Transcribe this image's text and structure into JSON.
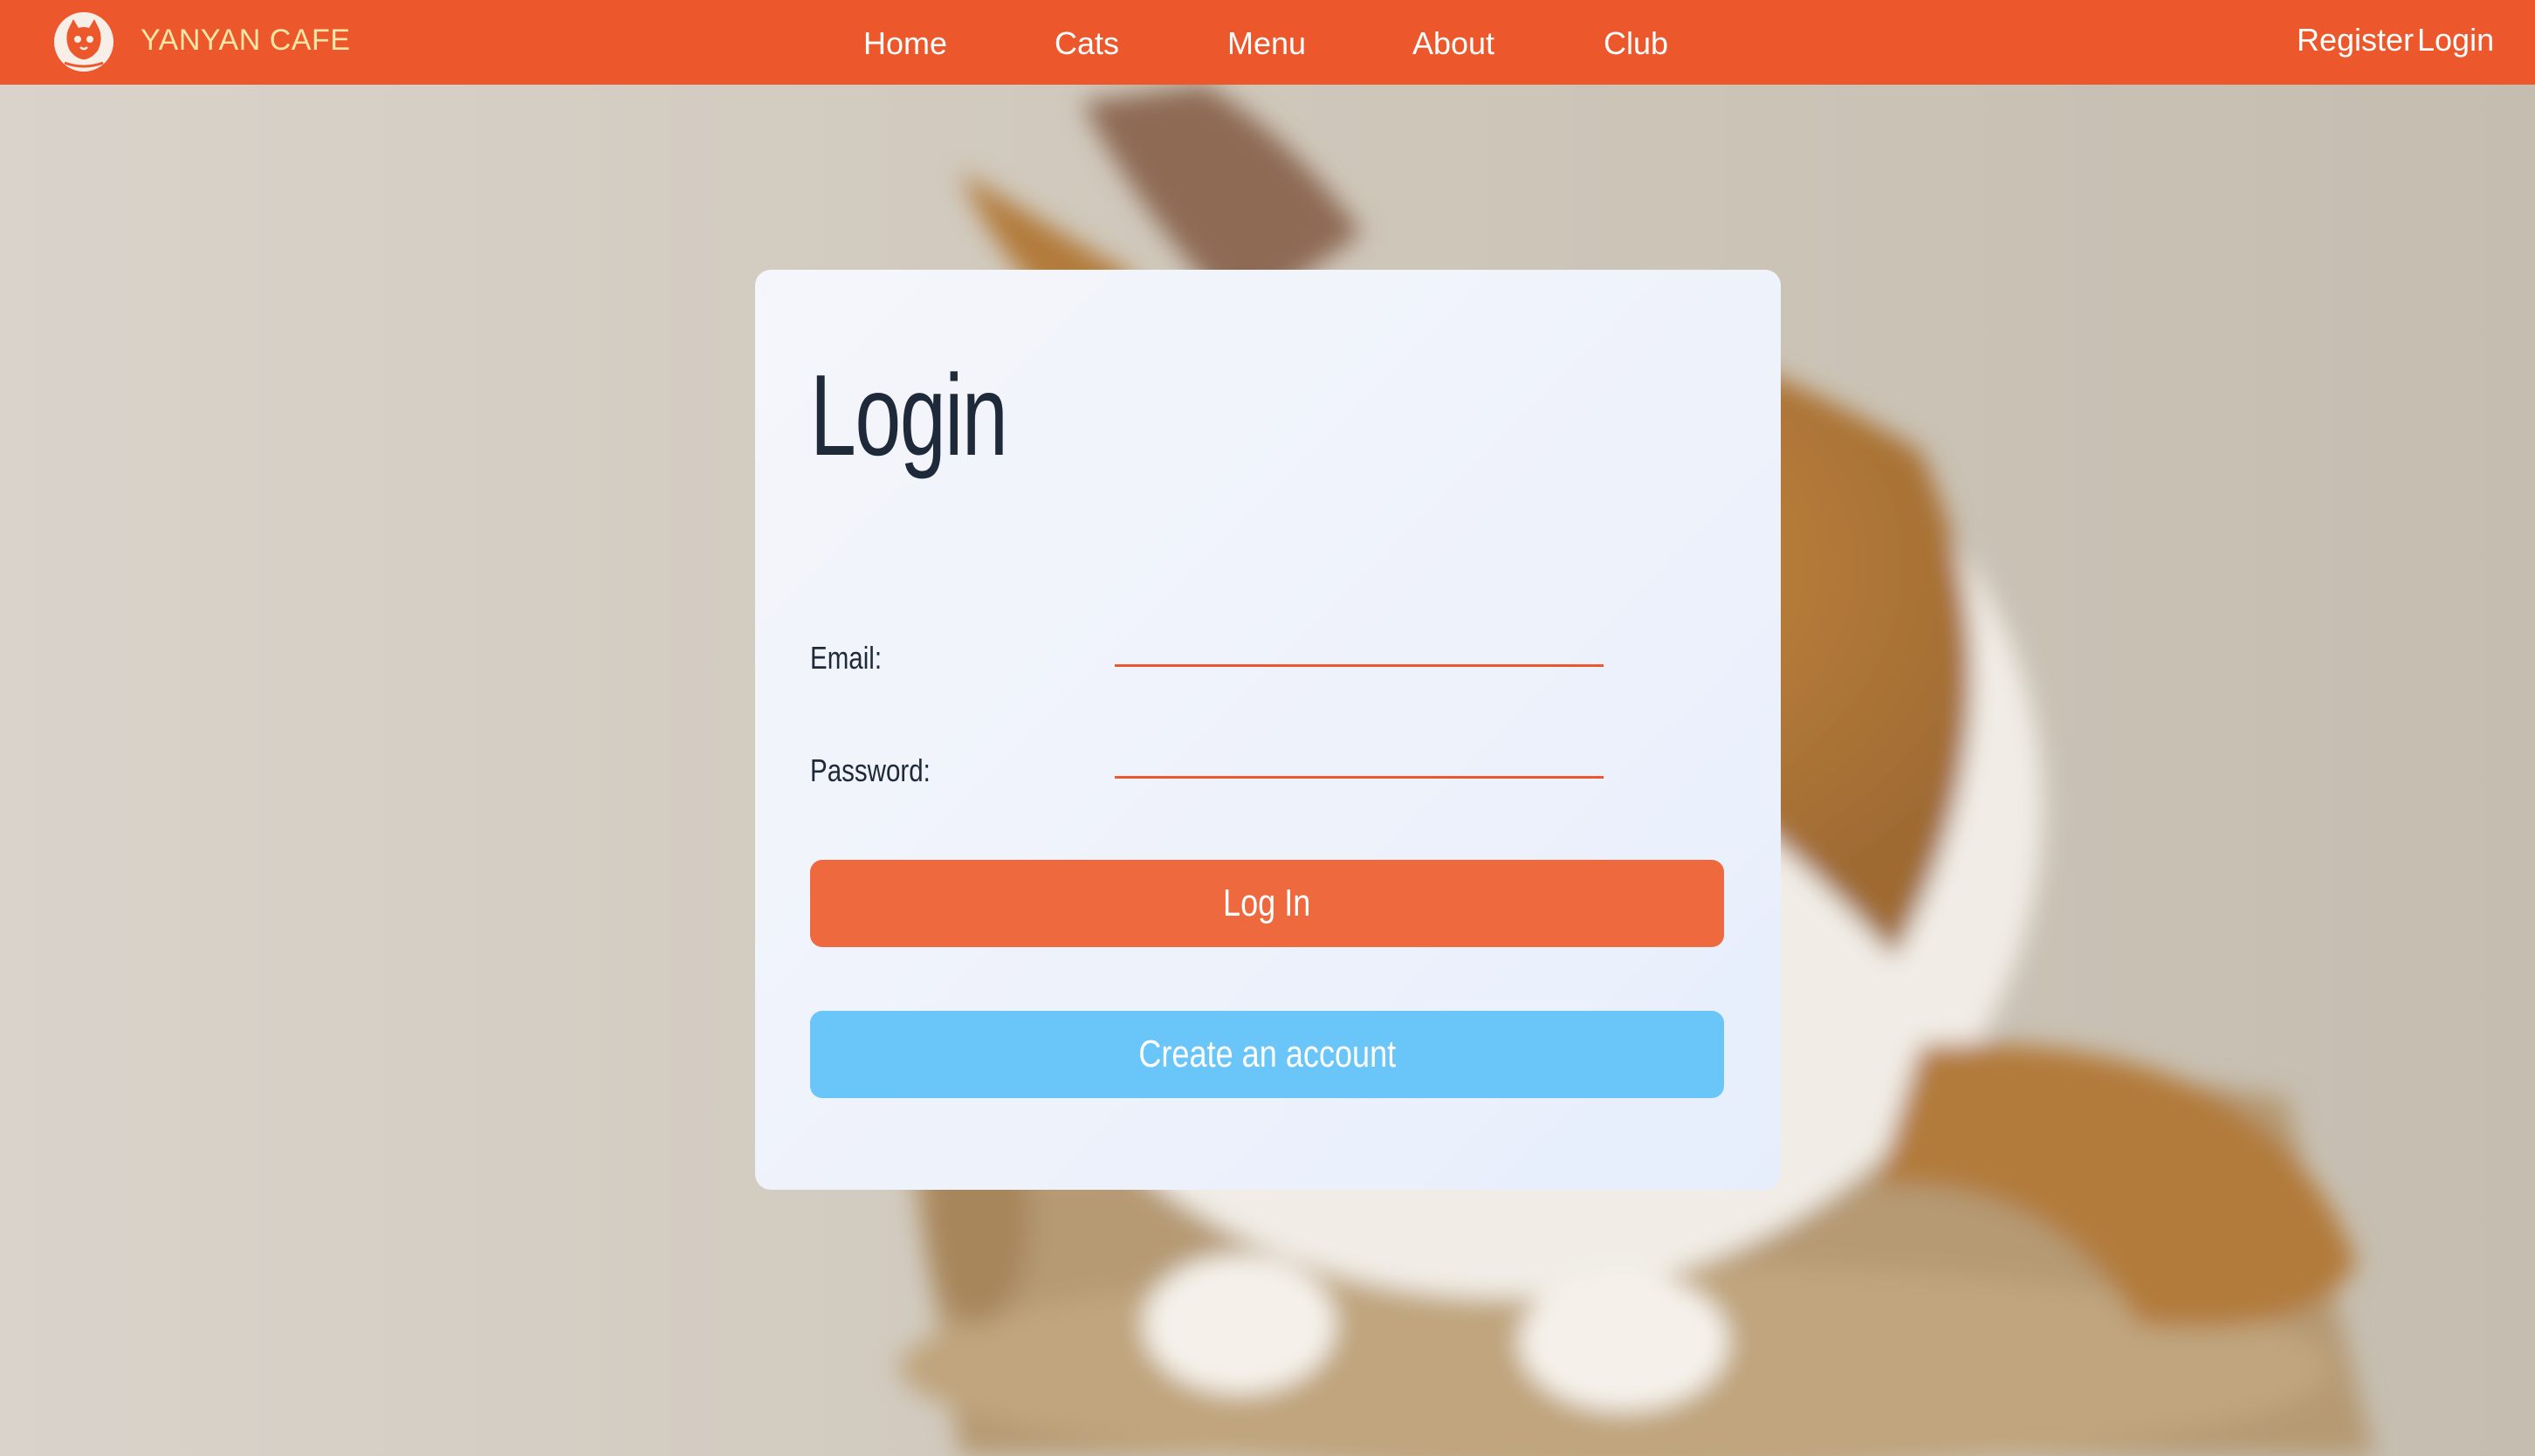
{
  "brand": {
    "name": "YANYAN CAFE",
    "logo_icon": "cat-logo-icon"
  },
  "nav": {
    "links": [
      "Home",
      "Cats",
      "Menu",
      "About",
      "Club"
    ],
    "register_label": "Register",
    "login_label": "Login"
  },
  "login_card": {
    "title": "Login",
    "email_label": "Email:",
    "email_value": "",
    "password_label": "Password:",
    "password_value": "",
    "login_button": "Log In",
    "create_button": "Create an account"
  },
  "colors": {
    "navbar": "#ec572b",
    "brand_text": "#fde7a6",
    "input_underline": "#ec572b",
    "login_button": "#ee693e",
    "create_button": "#6ac5f8",
    "title_text": "#1e2a3a"
  }
}
